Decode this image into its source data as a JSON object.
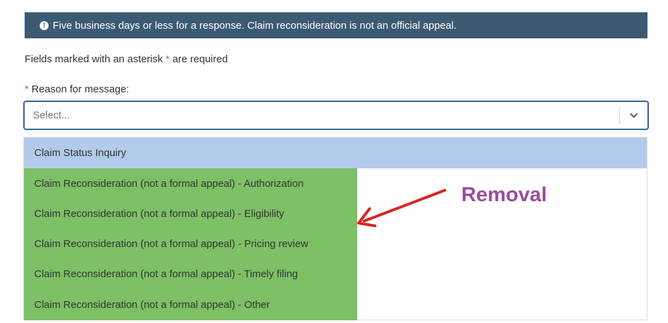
{
  "banner": {
    "icon": "info-icon",
    "text": "Five business days or less for a response. Claim reconsideration is not an official appeal."
  },
  "form": {
    "required_note_before": "Fields marked with an asterisk",
    "required_note_asterisk": "*",
    "required_note_after": "are required",
    "reason_label_asterisk": "*",
    "reason_label": "Reason for message:",
    "select_placeholder": "Select..."
  },
  "dropdown": {
    "options": [
      {
        "label": "Claim Status Inquiry",
        "state": "hovered"
      },
      {
        "label": "Claim Reconsideration (not a formal appeal) - Authorization",
        "state": "highlighted-green"
      },
      {
        "label": "Claim Reconsideration (not a formal appeal) - Eligibility",
        "state": "highlighted-green"
      },
      {
        "label": "Claim Reconsideration (not a formal appeal) - Pricing review",
        "state": "highlighted-green"
      },
      {
        "label": "Claim Reconsideration (not a formal appeal) - Timely filing",
        "state": "highlighted-green"
      },
      {
        "label": "Claim Reconsideration (not a formal appeal) - Other",
        "state": "highlighted-green"
      }
    ]
  },
  "annotation": {
    "text": "Removal",
    "arrow_color": "#e02020",
    "text_color": "#9b4c9e"
  },
  "colors": {
    "banner_bg": "#3d5a73",
    "focus_border": "#2f5fa7",
    "hover_option": "#b3cbea",
    "green_highlight": "#7dc066",
    "asterisk": "#d9534f"
  }
}
